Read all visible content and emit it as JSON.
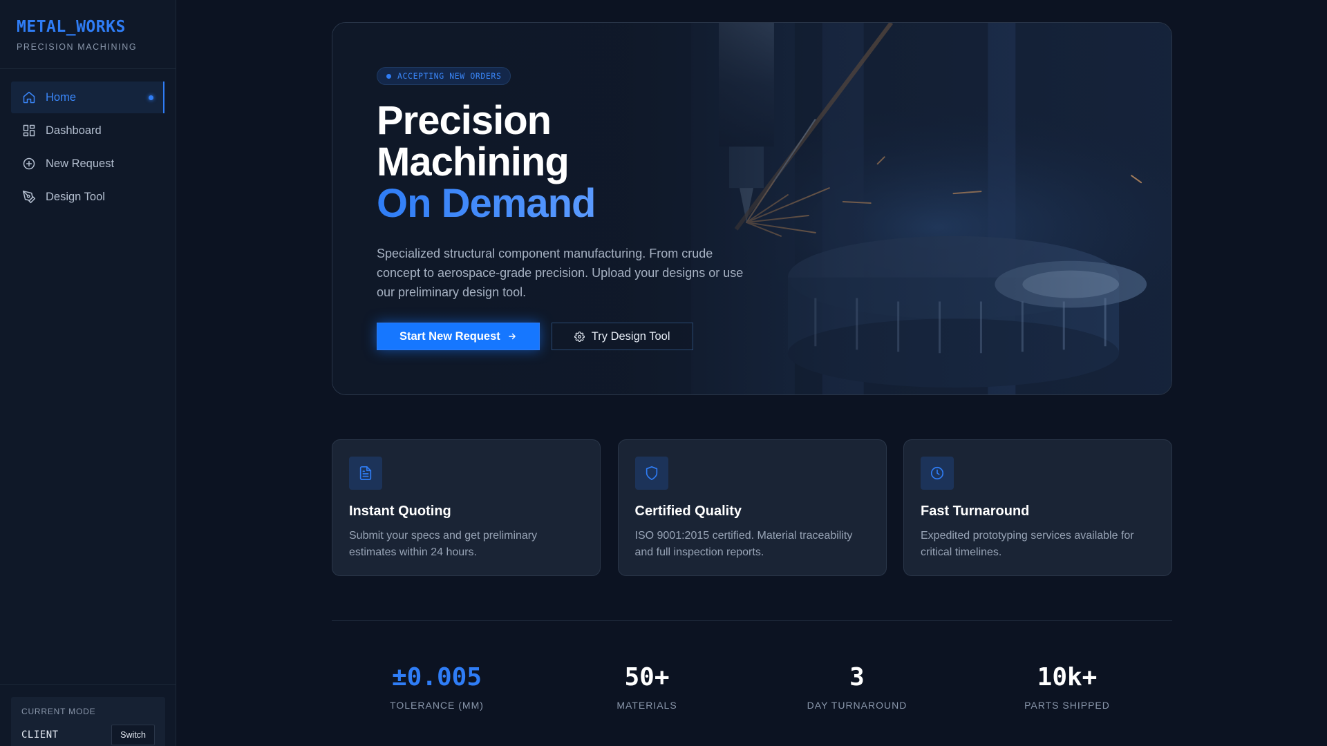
{
  "brand": {
    "name": "METAL_WORKS",
    "tagline": "PRECISION MACHINING"
  },
  "sidebar": {
    "items": [
      {
        "label": "Home",
        "icon": "home-icon",
        "active": true
      },
      {
        "label": "Dashboard",
        "icon": "grid-icon"
      },
      {
        "label": "New Request",
        "icon": "plus-circle-icon"
      },
      {
        "label": "Design Tool",
        "icon": "pen-tool-icon"
      }
    ],
    "mode": {
      "label": "CURRENT MODE",
      "value": "CLIENT",
      "switch_label": "Switch"
    }
  },
  "hero": {
    "badge": "ACCEPTING NEW ORDERS",
    "title_line1": "Precision",
    "title_line2": "Machining",
    "title_accent": "On Demand",
    "description": "Specialized structural component manufacturing. From crude concept to aerospace-grade precision. Upload your designs or use our preliminary design tool.",
    "primary_button": "Start New Request",
    "secondary_button": "Try Design Tool"
  },
  "features": [
    {
      "title": "Instant Quoting",
      "description": "Submit your specs and get preliminary estimates within 24 hours.",
      "icon": "document-icon"
    },
    {
      "title": "Certified Quality",
      "description": "ISO 9001:2015 certified. Material traceability and full inspection reports.",
      "icon": "shield-icon"
    },
    {
      "title": "Fast Turnaround",
      "description": "Expedited prototyping services available for critical timelines.",
      "icon": "clock-icon"
    }
  ],
  "stats": [
    {
      "value": "±0.005",
      "label": "TOLERANCE (MM)"
    },
    {
      "value": "50+",
      "label": "MATERIALS"
    },
    {
      "value": "3",
      "label": "DAY TURNAROUND"
    },
    {
      "value": "10k+",
      "label": "PARTS SHIPPED"
    }
  ],
  "colors": {
    "accent": "#2f7df6",
    "background": "#0c1322",
    "sidebar": "#0f1828",
    "card": "#1a2435"
  }
}
